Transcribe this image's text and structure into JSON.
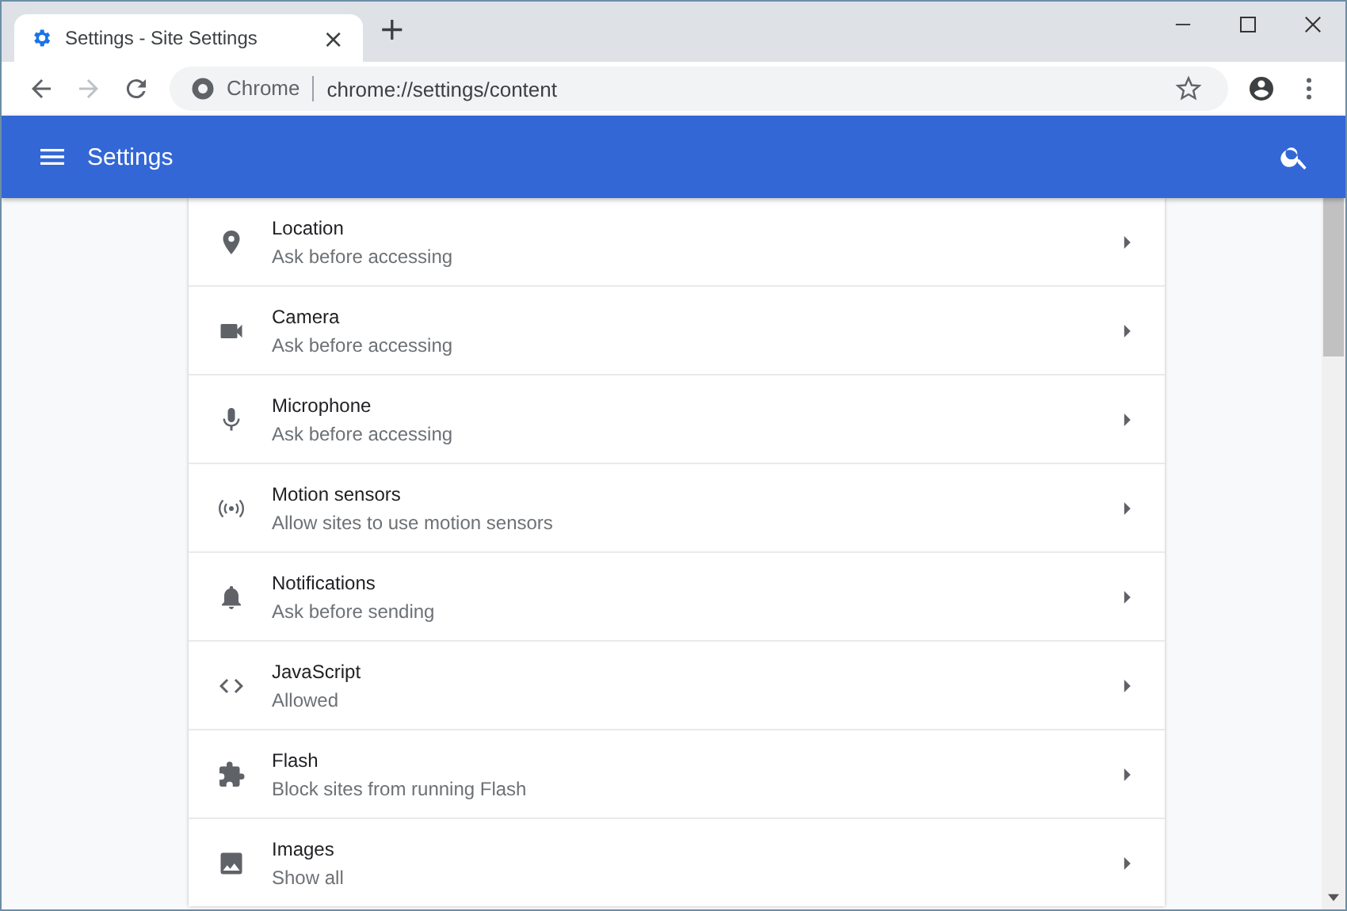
{
  "tab": {
    "title": "Settings - Site Settings",
    "close": "×",
    "new_tab": "+"
  },
  "toolbar": {
    "site_label": "Chrome",
    "url": "chrome://settings/content"
  },
  "header": {
    "title": "Settings"
  },
  "items": [
    {
      "kind": "location",
      "title": "Location",
      "subtitle": "Ask before accessing"
    },
    {
      "kind": "camera",
      "title": "Camera",
      "subtitle": "Ask before accessing"
    },
    {
      "kind": "microphone",
      "title": "Microphone",
      "subtitle": "Ask before accessing"
    },
    {
      "kind": "sensors",
      "title": "Motion sensors",
      "subtitle": "Allow sites to use motion sensors"
    },
    {
      "kind": "bell",
      "title": "Notifications",
      "subtitle": "Ask before sending"
    },
    {
      "kind": "code",
      "title": "JavaScript",
      "subtitle": "Allowed"
    },
    {
      "kind": "puzzle",
      "title": "Flash",
      "subtitle": "Block sites from running Flash"
    },
    {
      "kind": "image",
      "title": "Images",
      "subtitle": "Show all"
    }
  ]
}
